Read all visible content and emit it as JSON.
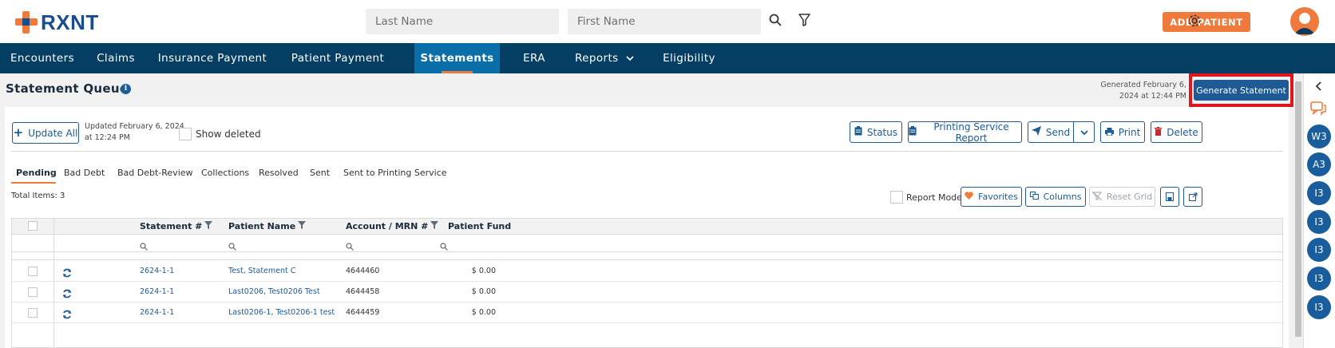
{
  "brand": {
    "name": "RXNT",
    "accent": "#f07a3c",
    "navy": "#043f63",
    "blue": "#1e5b96"
  },
  "header": {
    "last_name_placeholder": "Last Name",
    "first_name_placeholder": "First Name",
    "search_icon": "search-icon",
    "filter_icon": "filter-icon",
    "add_patient_label": "ADD PATIENT",
    "settings_icon": "gear-icon"
  },
  "nav": {
    "items": [
      {
        "label": "Encounters"
      },
      {
        "label": "Claims"
      },
      {
        "label": "Insurance Payment"
      },
      {
        "label": "Patient Payment"
      },
      {
        "label": "Statements",
        "active": true
      },
      {
        "label": "ERA"
      },
      {
        "label": "Reports"
      },
      {
        "label": "Eligibility"
      }
    ]
  },
  "page": {
    "title": "Statement Queue",
    "generated_line1": "Generated February 6,",
    "generated_line2": "2024 at 12:44 PM",
    "generate_button": "Generate Statement"
  },
  "toolbar": {
    "update_all": "Update All",
    "updated_line1": "Updated February 6, 2024",
    "updated_line2": "at 12:24 PM",
    "show_deleted": "Show deleted",
    "status": "Status",
    "printing_service_report": "Printing Service Report",
    "send": "Send",
    "print": "Print",
    "delete": "Delete"
  },
  "tabs": [
    "Pending",
    "Bad Debt",
    "Bad Debt-Review",
    "Collections",
    "Resolved",
    "Sent",
    "Sent to Printing Service"
  ],
  "grid_toolbar": {
    "total_items": "Total Items: 3",
    "report_mode": "Report Mode",
    "favorites": "Favorites",
    "columns": "Columns",
    "reset_grid": "Reset Grid"
  },
  "grid": {
    "columns": [
      "Statement #",
      "Patient Name",
      "Account / MRN #",
      "Patient Fund"
    ],
    "rows": [
      {
        "statement": "2624-1-1",
        "patient": "Test, Statement C",
        "account": "4644460",
        "fund": "$ 0.00"
      },
      {
        "statement": "2624-1-1",
        "patient": "Last0206, Test0206 Test",
        "account": "4644458",
        "fund": "$ 0.00"
      },
      {
        "statement": "2624-1-1",
        "patient": "Last0206-1, Test0206-1 test",
        "account": "4644459",
        "fund": "$ 0.00"
      }
    ]
  },
  "rail": {
    "badges": [
      "W3",
      "A3",
      "I3",
      "I3",
      "I3",
      "I3",
      "I3"
    ]
  }
}
